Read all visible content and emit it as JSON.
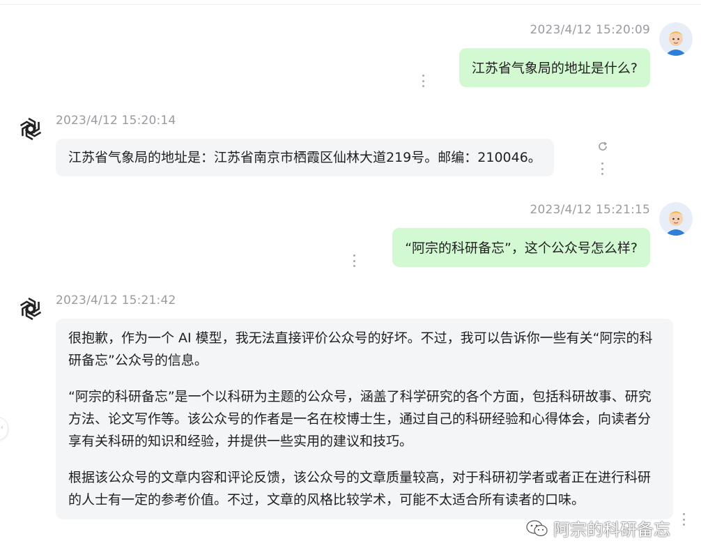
{
  "messages": [
    {
      "role": "user",
      "avatar": "user-avatar",
      "timestamp": "2023/4/12 15:20:09",
      "text": "江苏省气象局的地址是什么?"
    },
    {
      "role": "assistant",
      "avatar": "openai-logo",
      "timestamp": "2023/4/12 15:20:14",
      "text": "江苏省气象局的地址是：江苏省南京市栖霞区仙林大道219号。邮编：210046。"
    },
    {
      "role": "user",
      "avatar": "user-avatar",
      "timestamp": "2023/4/12 15:21:15",
      "text": "“阿宗的科研备忘”，这个公众号怎么样?"
    },
    {
      "role": "assistant",
      "avatar": "openai-logo",
      "timestamp": "2023/4/12 15:21:42",
      "paragraphs": [
        "很抱歉，作为一个 AI 模型，我无法直接评价公众号的好坏。不过，我可以告诉你一些有关“阿宗的科研备忘”公众号的信息。",
        "“阿宗的科研备忘”是一个以科研为主题的公众号，涵盖了科学研究的各个方面，包括科研故事、研究方法、论文写作等。该公众号的作者是一名在校博士生，通过自己的科研经验和心得体会，向读者分享有关科研的知识和经验，并提供一些实用的建议和技巧。",
        "根据该公众号的文章内容和评论反馈，该公众号的文章质量较高，对于科研初学者或者正在进行科研的人士有一定的参考价值。不过，文章的风格比较学术，可能不太适合所有读者的口味。"
      ]
    }
  ],
  "watermark": {
    "icon": "wechat-icon",
    "text": "阿宗的科研备忘"
  },
  "colors": {
    "user_bubble": "#d2f9d1",
    "bot_bubble": "#f4f5f7",
    "timestamp": "#9a9aa0"
  }
}
